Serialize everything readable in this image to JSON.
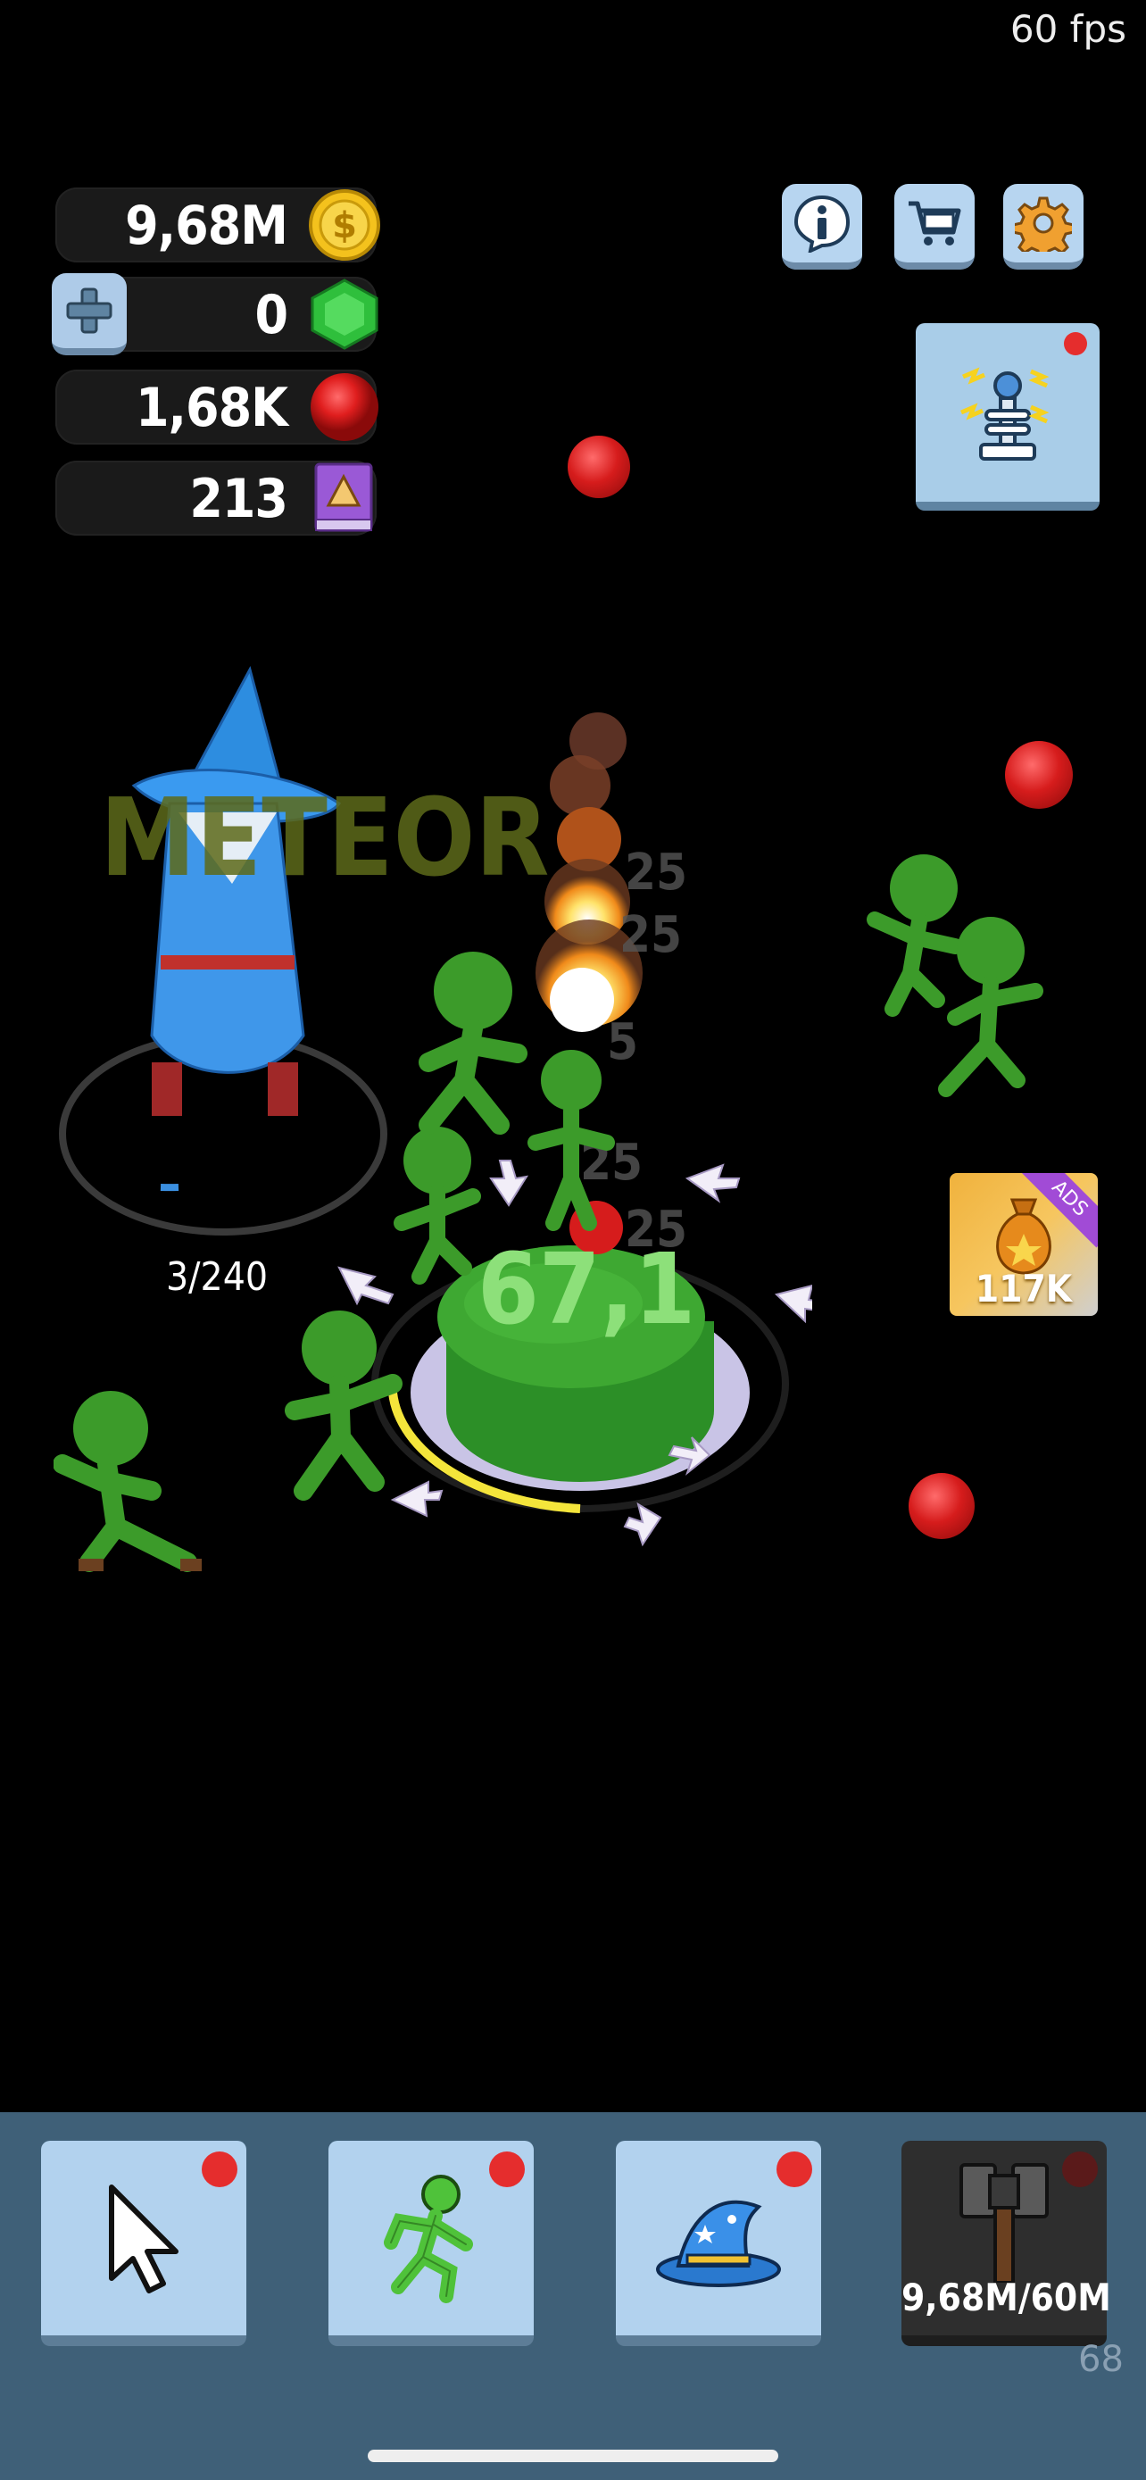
{
  "hud": {
    "fps": "60 fps",
    "coins": "9,68M",
    "gems": "0",
    "red_balls": "1,68K",
    "books": "213"
  },
  "game": {
    "floating_text": "METEOR",
    "wizard_counter": "3/240",
    "button_hp": "67,1",
    "damage_numbers": [
      "25",
      "25",
      "5",
      "25",
      "25"
    ]
  },
  "ads_offer": {
    "ribbon": "ADS",
    "value": "117K"
  },
  "bottom_bar": {
    "hammer_progress": "9,68M/60M",
    "level": "68"
  },
  "colors": {
    "button_blue": "#b2d2ee",
    "panel": "#3f6078",
    "zombie_green": "#4fb32e",
    "notification_red": "#e52d2d"
  },
  "icons": [
    "coin-icon",
    "gem-icon",
    "red-ball-icon",
    "book-icon",
    "plus-icon",
    "info-icon",
    "cart-icon",
    "gear-icon",
    "tesla-coil-icon",
    "cursor-icon",
    "runner-icon",
    "wizard-hat-icon",
    "hammer-icon"
  ]
}
